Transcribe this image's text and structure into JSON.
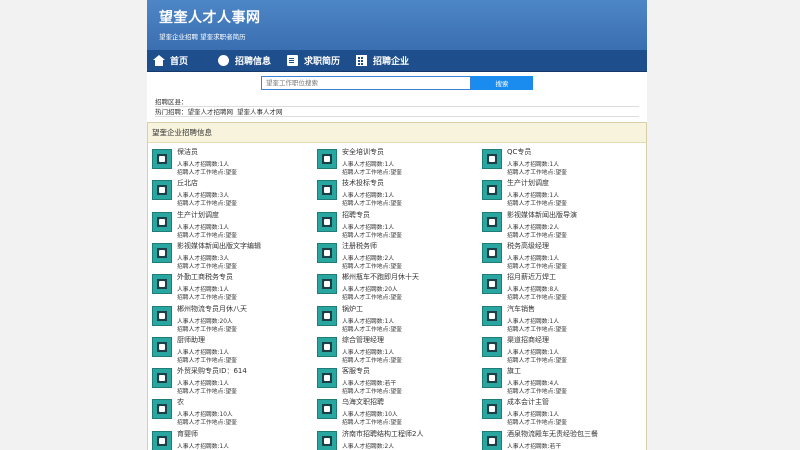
{
  "site": {
    "title": "望奎人才人事网",
    "subtitle": "望奎企业招聘 望奎求职者简历"
  },
  "nav": {
    "items": [
      {
        "label": "首页",
        "icon": "home-icon"
      },
      {
        "label": "招聘信息",
        "icon": "chat-icon"
      },
      {
        "label": "求职简历",
        "icon": "document-icon"
      },
      {
        "label": "招聘企业",
        "icon": "building-icon"
      }
    ]
  },
  "search": {
    "placeholder": "望奎工作职位搜索",
    "button": "搜索"
  },
  "area": {
    "label": "招聘区县："
  },
  "hot": {
    "label": "热门招聘：",
    "links": [
      "望奎人才招聘网",
      "望奎人事人才网"
    ]
  },
  "section": {
    "title": "望奎企业招聘信息"
  },
  "jobs": [
    {
      "title": "保洁员",
      "count": "人事人才招聘数:1人",
      "place": "招聘人才工作地点:望奎"
    },
    {
      "title": "安全培训专员",
      "count": "人事人才招聘数:1人",
      "place": "招聘人才工作地点:望奎"
    },
    {
      "title": "QC专员",
      "count": "人事人才招聘数:1人",
      "place": "招聘人才工作地点:望奎"
    },
    {
      "title": "丘北店",
      "count": "人事人才招聘数:3人",
      "place": "招聘人才工作地点:望奎"
    },
    {
      "title": "技术投标专员",
      "count": "人事人才招聘数:1人",
      "place": "招聘人才工作地点:望奎"
    },
    {
      "title": "生产计划调度",
      "count": "人事人才招聘数:1人",
      "place": "招聘人才工作地点:望奎"
    },
    {
      "title": "生产计划调度",
      "count": "人事人才招聘数:1人",
      "place": "招聘人才工作地点:望奎"
    },
    {
      "title": "招聘专员",
      "count": "人事人才招聘数:1人",
      "place": "招聘人才工作地点:望奎"
    },
    {
      "title": "影视媒体新闻出版导演",
      "count": "人事人才招聘数:2人",
      "place": "招聘人才工作地点:望奎"
    },
    {
      "title": "影视媒体新闻出版文字编辑",
      "count": "人事人才招聘数:3人",
      "place": "招聘人才工作地点:望奎"
    },
    {
      "title": "注册税务师",
      "count": "人事人才招聘数:2人",
      "place": "招聘人才工作地点:望奎"
    },
    {
      "title": "税务高级经理",
      "count": "人事人才招聘数:1人",
      "place": "招聘人才工作地点:望奎"
    },
    {
      "title": "外勤工商税务专员",
      "count": "人事人才招聘数:1人",
      "place": "招聘人才工作地点:望奎"
    },
    {
      "title": "郴州瓶车不跑即月休十天",
      "count": "人事人才招聘数:20人",
      "place": "招聘人才工作地点:望奎"
    },
    {
      "title": "招月薪近万焊工",
      "count": "人事人才招聘数:8人",
      "place": "招聘人才工作地点:望奎"
    },
    {
      "title": "郴州物流专员月休八天",
      "count": "人事人才招聘数:20人",
      "place": "招聘人才工作地点:望奎"
    },
    {
      "title": "锅炉工",
      "count": "人事人才招聘数:1人",
      "place": "招聘人才工作地点:望奎"
    },
    {
      "title": "汽车销售",
      "count": "人事人才招聘数:1人",
      "place": "招聘人才工作地点:望奎"
    },
    {
      "title": "厨师助理",
      "count": "人事人才招聘数:1人",
      "place": "招聘人才工作地点:望奎"
    },
    {
      "title": "综合管理经理",
      "count": "人事人才招聘数:1人",
      "place": "招聘人才工作地点:望奎"
    },
    {
      "title": "渠道招商经理",
      "count": "人事人才招聘数:1人",
      "place": "招聘人才工作地点:望奎"
    },
    {
      "title": "外贸采购专员ID：614",
      "count": "人事人才招聘数:1人",
      "place": "招聘人才工作地点:望奎"
    },
    {
      "title": "客服专员",
      "count": "人事人才招聘数:若干",
      "place": "招聘人才工作地点:望奎"
    },
    {
      "title": "旗工",
      "count": "人事人才招聘数:4人",
      "place": "招聘人才工作地点:望奎"
    },
    {
      "title": "农",
      "count": "人事人才招聘数:10人",
      "place": "招聘人才工作地点:望奎"
    },
    {
      "title": "乌海文职招聘",
      "count": "人事人才招聘数:10人",
      "place": "招聘人才工作地点:望奎"
    },
    {
      "title": "成本会计主管",
      "count": "人事人才招聘数:1人",
      "place": "招聘人才工作地点:望奎"
    },
    {
      "title": "育婴师",
      "count": "人事人才招聘数:1人",
      "place": ""
    },
    {
      "title": "济南市招聘结构工程师2人",
      "count": "人事人才招聘数:2人",
      "place": ""
    },
    {
      "title": "酒泉物流殿车无责经验包三餐",
      "count": "人事人才招聘数:若干",
      "place": ""
    }
  ]
}
